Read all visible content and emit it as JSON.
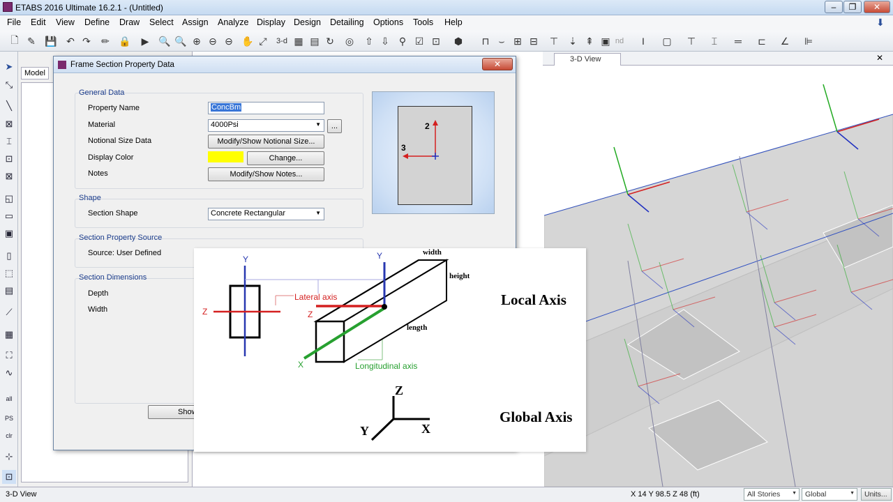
{
  "app": {
    "title": "ETABS 2016 Ultimate 16.2.1 - (Untitled)"
  },
  "menu": [
    "File",
    "Edit",
    "View",
    "Define",
    "Draw",
    "Select",
    "Assign",
    "Analyze",
    "Display",
    "Design",
    "Detailing",
    "Options",
    "Tools",
    "Help"
  ],
  "toolbar": {
    "view_3d": "3-d",
    "nd": "nd"
  },
  "left_panel": {
    "tab": "Model"
  },
  "view_tab": {
    "title": "3-D View"
  },
  "dialog": {
    "title": "Frame Section Property Data",
    "general_data": {
      "group": "General Data",
      "property_name_label": "Property Name",
      "property_name_value": "ConcBm",
      "material_label": "Material",
      "material_value": "4000Psi",
      "material_more": "...",
      "notional_label": "Notional Size Data",
      "notional_button": "Modify/Show Notional Size...",
      "color_label": "Display Color",
      "color_value": "#ffff00",
      "color_button": "Change...",
      "notes_label": "Notes",
      "notes_button": "Modify/Show Notes..."
    },
    "shape": {
      "group": "Shape",
      "label": "Section Shape",
      "value": "Concrete Rectangular"
    },
    "source": {
      "group": "Section Property Source",
      "text": "Source:  User Defined"
    },
    "dimensions": {
      "group": "Section Dimensions",
      "depth_label": "Depth",
      "width_label": "Width"
    },
    "preview": {
      "axis2": "2",
      "axis3": "3"
    },
    "show_button": "Show"
  },
  "overlay": {
    "y_left": "Y",
    "z_left": "Z",
    "lateral_axis": "Lateral axis",
    "y_beam": "Y",
    "z_beam": "Z",
    "x_beam": "X",
    "width": "width",
    "height": "height",
    "length": "length",
    "longitudinal_axis": "Longitudinal axis",
    "local_axis": "Local Axis",
    "global_z": "Z",
    "global_y": "Y",
    "global_x": "X",
    "global_axis": "Global Axis"
  },
  "status": {
    "left": "3-D View",
    "coords": "X 14  Y 98.5  Z 48 (ft)",
    "stories": "All Stories",
    "coord_sys": "Global",
    "units": "Units..."
  },
  "colors": {
    "axis_red": "#d42020",
    "axis_green": "#22aa22",
    "axis_blue": "#2030c0",
    "beam_green": "#27a030"
  }
}
